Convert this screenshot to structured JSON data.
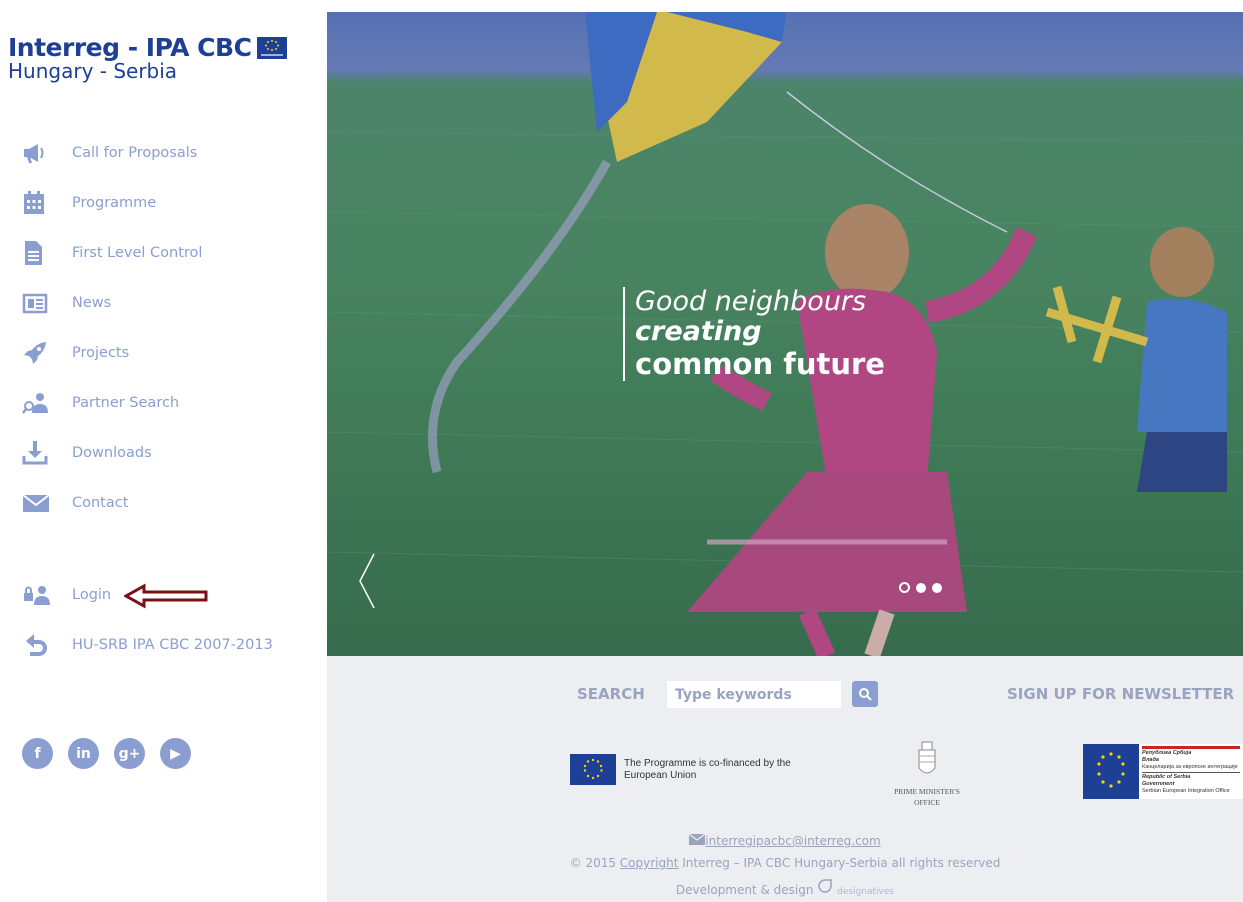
{
  "logo": {
    "line1": "Interreg - IPA CBC",
    "line2": "Hungary - Serbia"
  },
  "menu": [
    {
      "label": "Call for Proposals",
      "icon": "megaphone-icon"
    },
    {
      "label": "Programme",
      "icon": "calendar-icon"
    },
    {
      "label": "First Level Control",
      "icon": "document-icon"
    },
    {
      "label": "News",
      "icon": "newspaper-icon"
    },
    {
      "label": "Projects",
      "icon": "rocket-icon"
    },
    {
      "label": "Partner Search",
      "icon": "person-search-icon"
    },
    {
      "label": "Downloads",
      "icon": "download-icon"
    },
    {
      "label": "Contact",
      "icon": "envelope-icon"
    }
  ],
  "menu_secondary": [
    {
      "label": "Login",
      "icon": "login-users-icon"
    },
    {
      "label": "HU-SRB IPA CBC 2007-2013",
      "icon": "return-arrow-icon"
    }
  ],
  "socials": [
    {
      "label": "f",
      "icon": "facebook-icon"
    },
    {
      "label": "in",
      "icon": "linkedin-icon"
    },
    {
      "label": "g+",
      "icon": "google-plus-icon"
    },
    {
      "label": "▶",
      "icon": "youtube-icon"
    }
  ],
  "hero": {
    "line1": "Good neighbours",
    "line2": "creating",
    "line3": "common future",
    "slides_total": 3,
    "active_slide": 1
  },
  "footer": {
    "search_label": "SEARCH",
    "search_placeholder": "Type keywords",
    "newsletter_label": "SIGN UP FOR NEWSLETTER",
    "eu_text": "The Programme is co-financed by the European Union",
    "pm_text_line1": "PRIME MINISTER'S",
    "pm_text_line2": "OFFICE",
    "rs_text": {
      "line1": "Република Србија",
      "line2": "Влада",
      "line3": "Канцеларија за европске интеграције",
      "line4": "Republic of Serbia",
      "line5": "Government",
      "line6": "Serbian European Integration Office"
    },
    "email": "interregipacbc@interreg.com",
    "copyright_prefix": "© 2015 ",
    "copyright_link": "Copyright",
    "copyright_suffix": " Interreg – IPA CBC Hungary-Serbia all rights reserved",
    "dev_label": "Development & design",
    "dev_brand": "designatives"
  },
  "colors": {
    "brand_blue": "#1e3f96",
    "menu_text": "#8b9ed2",
    "annotation_arrow": "#7a0f14"
  }
}
